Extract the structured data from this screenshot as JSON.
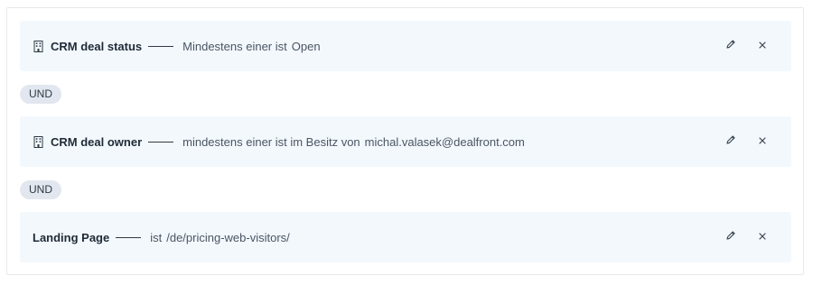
{
  "filters": [
    {
      "has_icon": true,
      "icon": "building-icon",
      "field": "CRM deal status",
      "condition": "Mindestens einer ist",
      "value": "Open"
    },
    {
      "has_icon": true,
      "icon": "building-icon",
      "field": "CRM deal owner",
      "condition": "mindestens einer ist im Besitz von",
      "value": "michal.valasek@dealfront.com"
    },
    {
      "has_icon": false,
      "field": "Landing Page",
      "condition": "ist",
      "value": "/de/pricing-web-visitors/"
    }
  ],
  "connectors": [
    "UND",
    "UND"
  ],
  "actions": {
    "edit_icon": "pencil-icon",
    "remove_icon": "close-icon"
  },
  "colors": {
    "row_background": "#f3f8fd",
    "badge_background": "#e2e7ef",
    "text_dark": "#1f2a36",
    "text_muted": "#4a5562"
  }
}
